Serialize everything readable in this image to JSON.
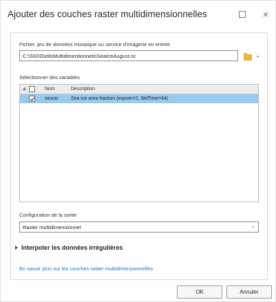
{
  "window": {
    "title": "Ajouter des couches raster multidimensionnelles",
    "maximize_label": "",
    "close_label": "×"
  },
  "input_section": {
    "label": "Fichier, jeu de données mosaïque ou service d'imagerie en entrée",
    "value": "C:\\SIG\\OutilsMultidimentionnels\\SeaIceAugust.nc"
  },
  "variables": {
    "label": "Sélectionner des variables",
    "columns": {
      "name": "Nom",
      "description": "Description"
    },
    "rows": [
      {
        "checked": true,
        "name": "siconc",
        "description": "Sea ice area fraction (expver=2, StdTime=64)"
      }
    ]
  },
  "output_config": {
    "label": "Configuration de la sortie",
    "selected": "Raster multidimensionnel"
  },
  "interpolate": {
    "label": "Interpoler les données irrégulières"
  },
  "learn_more": {
    "text": "En savoir plus sur les couches raster multidimensionnelles"
  },
  "buttons": {
    "ok": "OK",
    "cancel": "Annuler"
  },
  "colors": {
    "selected_row": "#99c9ec",
    "link": "#1f6fbf",
    "folder": "#e6b43c"
  }
}
